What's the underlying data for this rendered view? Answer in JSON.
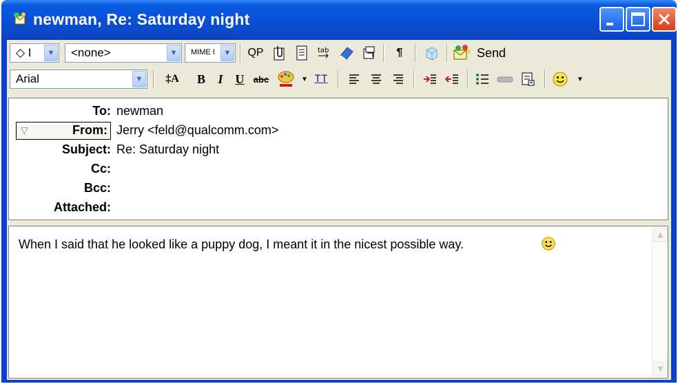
{
  "window": {
    "title": "newman, Re: Saturday night",
    "controls": {
      "minimize": "minimize-icon",
      "maximize": "maximize-icon",
      "close": "close-icon"
    }
  },
  "toolbar1": {
    "priority_value": "◇ I",
    "signature_value": "<none>",
    "mime_value": "MIME I",
    "buttons": [
      "QP",
      "attach",
      "page",
      "tab",
      "spell",
      "address-book",
      "¶",
      "cube",
      "Send"
    ],
    "send_label": "Send"
  },
  "toolbar2": {
    "font_value": "Arial",
    "bold": "B",
    "italic": "I",
    "underline": "U",
    "strike": "abc",
    "teletype": "TT",
    "font_size": "A"
  },
  "header": {
    "to_label": "To:",
    "to_value": "newman",
    "from_label": "From:",
    "from_value": "Jerry <feld@qualcomm.com>",
    "subject_label": "Subject:",
    "subject_value": "Re: Saturday night",
    "cc_label": "Cc:",
    "bcc_label": "Bcc:",
    "attached_label": "Attached:"
  },
  "message": {
    "body": "When I said that he looked like a puppy dog, I meant it in the nicest possible way."
  },
  "colors": {
    "title_bar": "#0a4fd6",
    "client_bg": "#ece9d8",
    "close_button": "#d63c15"
  }
}
